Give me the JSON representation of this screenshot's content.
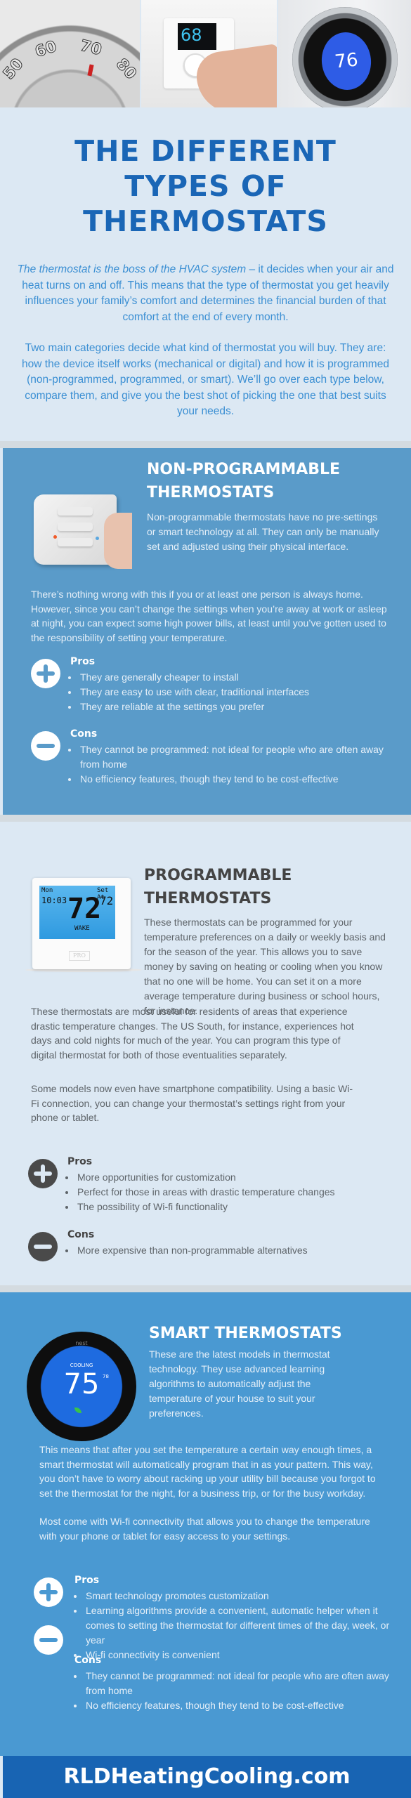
{
  "hero": {
    "images": [
      {
        "name": "dial-thermostat",
        "dial_labels": [
          "50",
          "60",
          "70",
          "80"
        ]
      },
      {
        "name": "digital-thermostat",
        "display_value": "68"
      },
      {
        "name": "round-smart-thermostat",
        "display_value": "76"
      }
    ]
  },
  "intro": {
    "title_lines": [
      "THE DIFFERENT",
      "TYPES OF",
      "THERMOSTATS"
    ],
    "paragraph1_italic": "The thermostat is the boss of the HVAC system",
    "paragraph1_rest": " – it decides when your air and heat turns on and off. This means that the type of thermostat you get heavily influences your family’s comfort and determines the financial burden of that comfort at the end of every month.",
    "paragraph2": "Two main categories decide what kind of thermostat you will buy. They are: how the device itself works (mechanical or digital) and how it is programmed (non-programmed, programmed, or smart). We’ll go over each type below, compare them, and give you the best shot of picking the one that best suits your needs."
  },
  "sections": [
    {
      "title_lines": [
        "NON-PROGRAMMABLE",
        "THERMOSTATS"
      ],
      "description": "Non-programmable thermostats have no pre-settings or smart technology at all. They can only be manually set and adjusted using their physical interface.",
      "body": [
        "There’s nothing wrong with this if you or at least one person is always home. However, since you can’t change the settings when you’re away at work or asleep at night, you can expect some high power bills, at least until you’ve gotten used to the responsibility of setting your temperature."
      ],
      "pros_label": "Pros",
      "pros": [
        "They are generally cheaper to install",
        "They are easy to use with clear, traditional interfaces",
        "They are reliable at the settings you prefer"
      ],
      "cons_label": "Cons",
      "cons": [
        "They cannot be programmed: not ideal for people who are often away from home",
        "No efficiency features, though they tend to be cost-effective"
      ]
    },
    {
      "title_lines": [
        "PROGRAMMABLE",
        "THERMOSTATS"
      ],
      "image": {
        "day": "Mon",
        "time": "10:03",
        "temp": "72",
        "set_at_label": "Set At",
        "set_temp": "72",
        "mode": "WAKE",
        "brand": "PRO"
      },
      "description": "These thermostats can be programmed for your temperature preferences on a daily or weekly basis and for the season of the year. This allows you to save money by saving on heating or cooling when you know that no one will be home. You can set it on a more average temperature during business or school hours, for instance.",
      "body": [
        "These thermostats are most useful for residents of areas that experience drastic temperature changes. The US South, for instance, experiences hot days and cold nights for much of the year. You can program this type of digital thermostat for both of those eventualities separately.",
        "Some models now even have smartphone compatibility. Using a basic Wi-Fi connection, you can change your thermostat’s settings right from your phone or tablet."
      ],
      "pros_label": "Pros",
      "pros": [
        "More opportunities for customization",
        "Perfect for those in areas with drastic temperature changes",
        "The possibility of Wi-fi functionality"
      ],
      "cons_label": "Cons",
      "cons": [
        "More expensive than non-programmable alternatives"
      ]
    },
    {
      "title_lines": [
        "SMART THERMOSTATS"
      ],
      "image": {
        "brand": "nest",
        "mode": "COOLING",
        "temp": "75",
        "target": "78"
      },
      "description": "These are the latest models in thermostat technology. They use advanced learning algorithms to automatically adjust the temperature of your house to suit your preferences.",
      "body": [
        "This means that after you set the temperature a certain way enough times, a smart thermostat will automatically program that in as your pattern. This way, you don’t have to worry about racking up your utility bill because you forgot to set the thermostat for the night, for a business trip, or for the busy workday.",
        "Most come with Wi-fi connectivity that allows you to change the temperature with your phone or tablet for easy access to your settings."
      ],
      "pros_label": "Pros",
      "pros": [
        "Smart technology promotes customization",
        "Learning algorithms provide a convenient, automatic helper when it comes to setting the thermostat for different times of the day, week, or year",
        "Wi-fi connectivity is convenient"
      ],
      "cons_label": "Cons",
      "cons": [
        "They cannot be programmed: not ideal for people who are often away from home",
        "No efficiency features, though they tend to be cost-effective"
      ]
    }
  ],
  "footer": {
    "website": "RLDHeatingCooling.com"
  },
  "colors": {
    "page_background": "#dce8f3",
    "title_blue": "#1a66b6",
    "intro_text_blue": "#3b8fd3",
    "section1_background": "#5a9bc9",
    "section3_background": "#4a99d2",
    "footer_background": "#1864b3",
    "dark_heading": "#444444"
  }
}
